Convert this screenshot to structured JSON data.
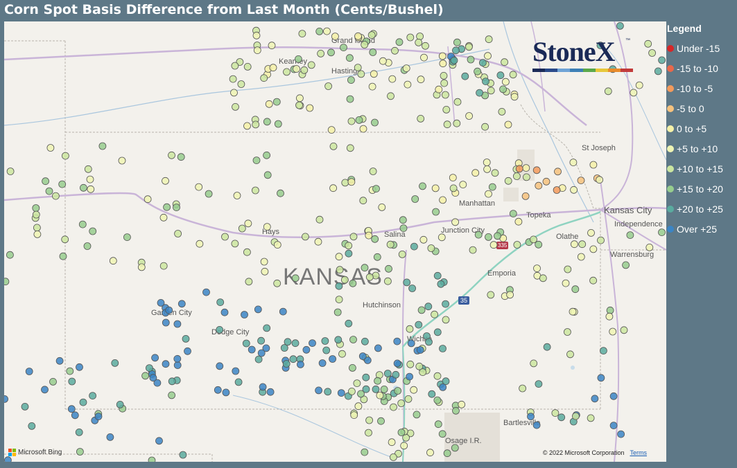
{
  "title": "Corn Spot Basis Difference from Last Month (Cents/Bushel)",
  "legend": {
    "title": "Legend",
    "items": [
      {
        "label": "Under -15",
        "color": "#d62728"
      },
      {
        "label": "-15 to -10",
        "color": "#e9684a"
      },
      {
        "label": "-10 to -5",
        "color": "#f39a5c"
      },
      {
        "label": "-5 to 0",
        "color": "#f6c27e"
      },
      {
        "label": "0 to +5",
        "color": "#f5f1a8"
      },
      {
        "label": "+5 to +10",
        "color": "#eef4b4"
      },
      {
        "label": "+10 to +15",
        "color": "#cbe6a0"
      },
      {
        "label": "+15 to +20",
        "color": "#97cd8e"
      },
      {
        "label": "+20 to +25",
        "color": "#5aab9f"
      },
      {
        "label": "Over +25",
        "color": "#3b85c5"
      }
    ]
  },
  "logo": {
    "text": "StoneX",
    "tm": "™",
    "colors": [
      "#1a2a57",
      "#2a4a8a",
      "#6fa3d6",
      "#3c7fb5",
      "#5aa84a",
      "#e7c83a",
      "#e98b2a",
      "#c23a3a"
    ]
  },
  "map": {
    "state_label": "KANSAS",
    "places": [
      "Grand Island",
      "Kearney",
      "Hastings",
      "St Joseph",
      "Manhattan",
      "Topeka",
      "Kansas City",
      "Independence",
      "Hays",
      "Salina",
      "Junction City",
      "Olathe",
      "Emporia",
      "Warrensburg",
      "Garden City",
      "Dodge City",
      "Hutchinson",
      "Wichita",
      "Bartlesville",
      "Osage I.R."
    ],
    "highways": [
      "335",
      "35"
    ],
    "attribution": {
      "provider": "Microsoft Bing",
      "copyright": "© 2022 Microsoft Corporation",
      "terms": "Terms"
    }
  }
}
